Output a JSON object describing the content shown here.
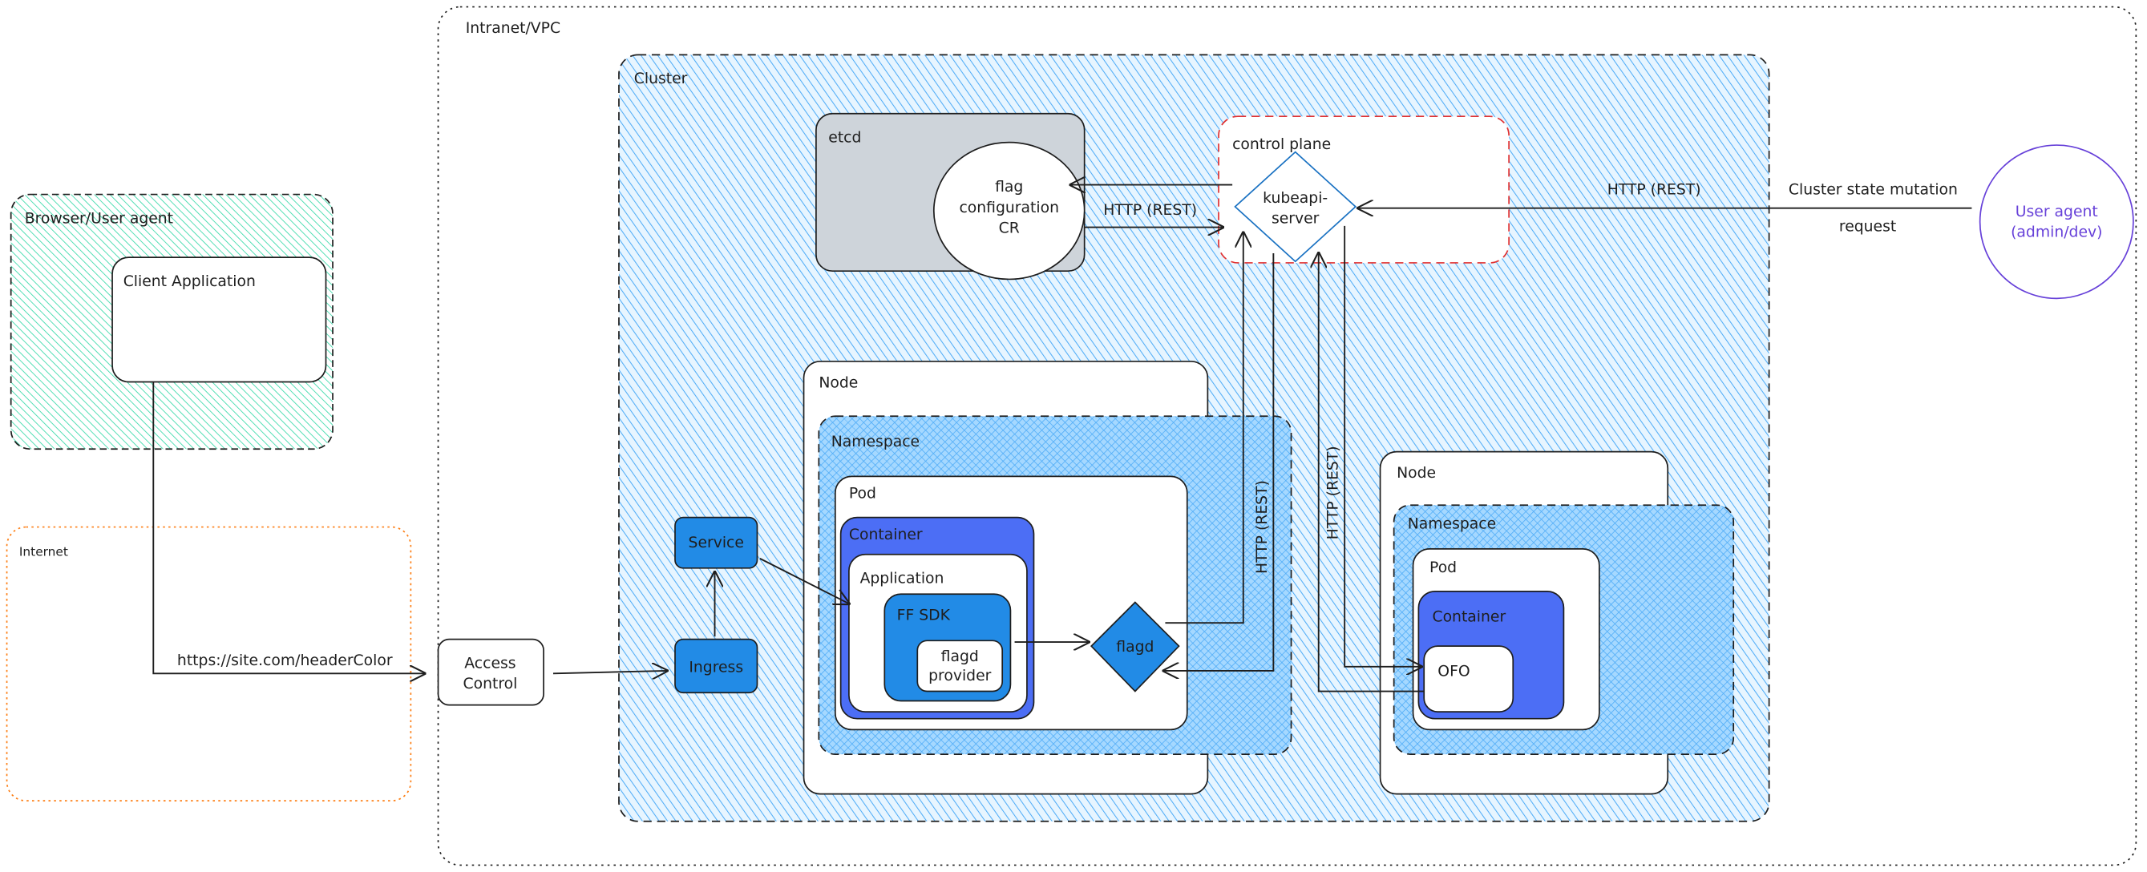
{
  "colors": {
    "cluster_fill": "#a5d8ff",
    "cluster_hatch": "#4dabf7",
    "browser_hatch": "#38d9a9",
    "internet_border": "#fd7e14",
    "control_plane_border": "#e03131",
    "etcd_fill": "#ced4da",
    "container_fill": "#4c6ef5",
    "blue_box_fill": "#228be6",
    "user_agent": "#6741d9"
  },
  "zones": {
    "intranet": "Intranet/VPC",
    "cluster": "Cluster",
    "browser": "Browser/User agent",
    "internet": "Internet",
    "etcd": "etcd",
    "control_plane": "control plane"
  },
  "nodes": {
    "client_app": "Client Application",
    "flag_cr": [
      "flag",
      "configuration",
      "CR"
    ],
    "kubeapi": [
      "kubeapi-",
      "server"
    ],
    "user_agent": [
      "User agent",
      "(admin/dev)"
    ],
    "access_control": [
      "Access",
      "Control"
    ],
    "ingress": "Ingress",
    "service": "Service",
    "node1": "Node",
    "namespace1": "Namespace",
    "pod1": "Pod",
    "container1": "Container",
    "application": "Application",
    "ff_sdk": "FF SDK",
    "flagd_provider": [
      "flagd",
      "provider"
    ],
    "flagd": "flagd",
    "node2": "Node",
    "namespace2": "Namespace",
    "pod2": "Pod",
    "container2": "Container",
    "ofo": "OFO"
  },
  "edges": {
    "client_url": "https://site.com/headerColor",
    "etcd_http": "HTTP (REST)",
    "user_http": "HTTP (REST)",
    "user_request": [
      "Cluster state mutation",
      "request"
    ],
    "flagd_http": "HTTP (REST)",
    "ofo_http": "HTTP (REST)"
  }
}
